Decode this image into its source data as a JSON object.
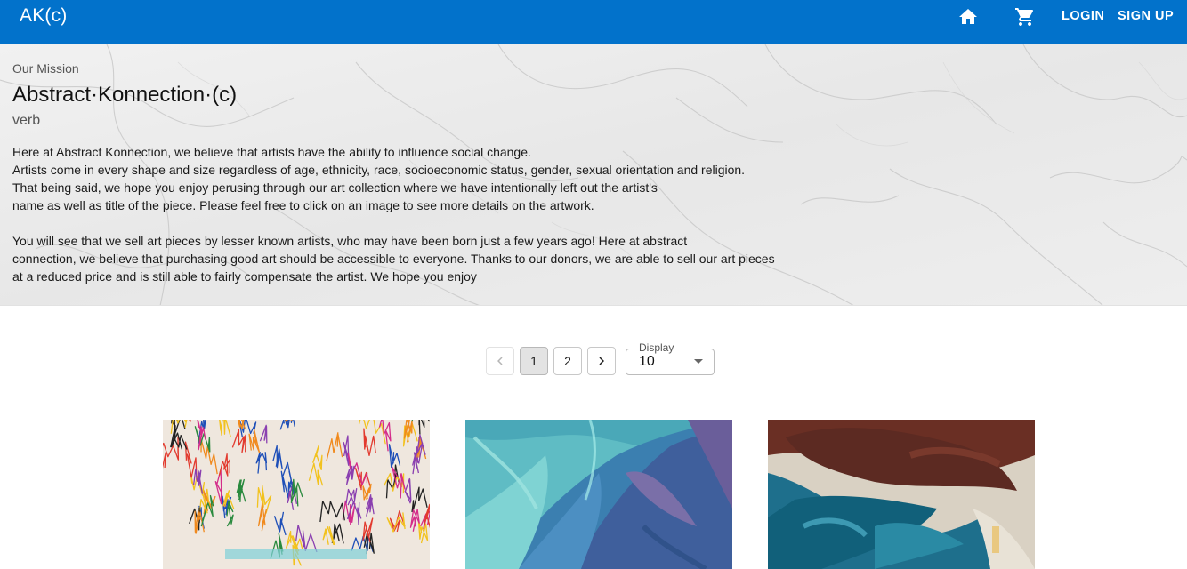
{
  "header": {
    "brand": "AK(c)",
    "home_icon": "home-icon",
    "cart_icon": "shopping-cart-icon",
    "login_label": "LOGIN",
    "signup_label": "SIGN UP",
    "bar_color": "#0272cb"
  },
  "mission": {
    "eyebrow": "Our Mission",
    "title": "Abstract·Konnection·(c)",
    "part_of_speech": "verb",
    "paragraph1": [
      "Here at Abstract Konnection, we believe that artists have the ability to influence social change.",
      "Artists come in every shape and size regardless of age, ethnicity, race, socioeconomic status, gender, sexual orientation and religion.",
      "That being said, we hope you enjoy perusing through our art collection where we have intentionally left out the artist's",
      "name as well as title of the piece. Please feel free to click on an image to see more details on the artwork."
    ],
    "paragraph2": [
      "You will see that we sell art pieces by lesser known artists, who may have been born just a few years ago! Here at abstract",
      "connection, we believe that purchasing good art should be accessible to everyone. Thanks to our donors, we are able to sell our art pieces",
      "at a reduced price and is still able to fairly compensate the artist. We hope you enjoy"
    ]
  },
  "pagination": {
    "prev_icon": "chevron-left-icon",
    "pages": [
      "1",
      "2"
    ],
    "current_page": "1",
    "next_icon": "chevron-right-icon",
    "display_label": "Display",
    "display_value": "10",
    "dropdown_icon": "caret-down-icon"
  },
  "artworks": [
    {
      "name": "artwork-colorful-scribbles"
    },
    {
      "name": "artwork-blue-teal-strokes"
    },
    {
      "name": "artwork-brown-teal-abstract"
    }
  ]
}
